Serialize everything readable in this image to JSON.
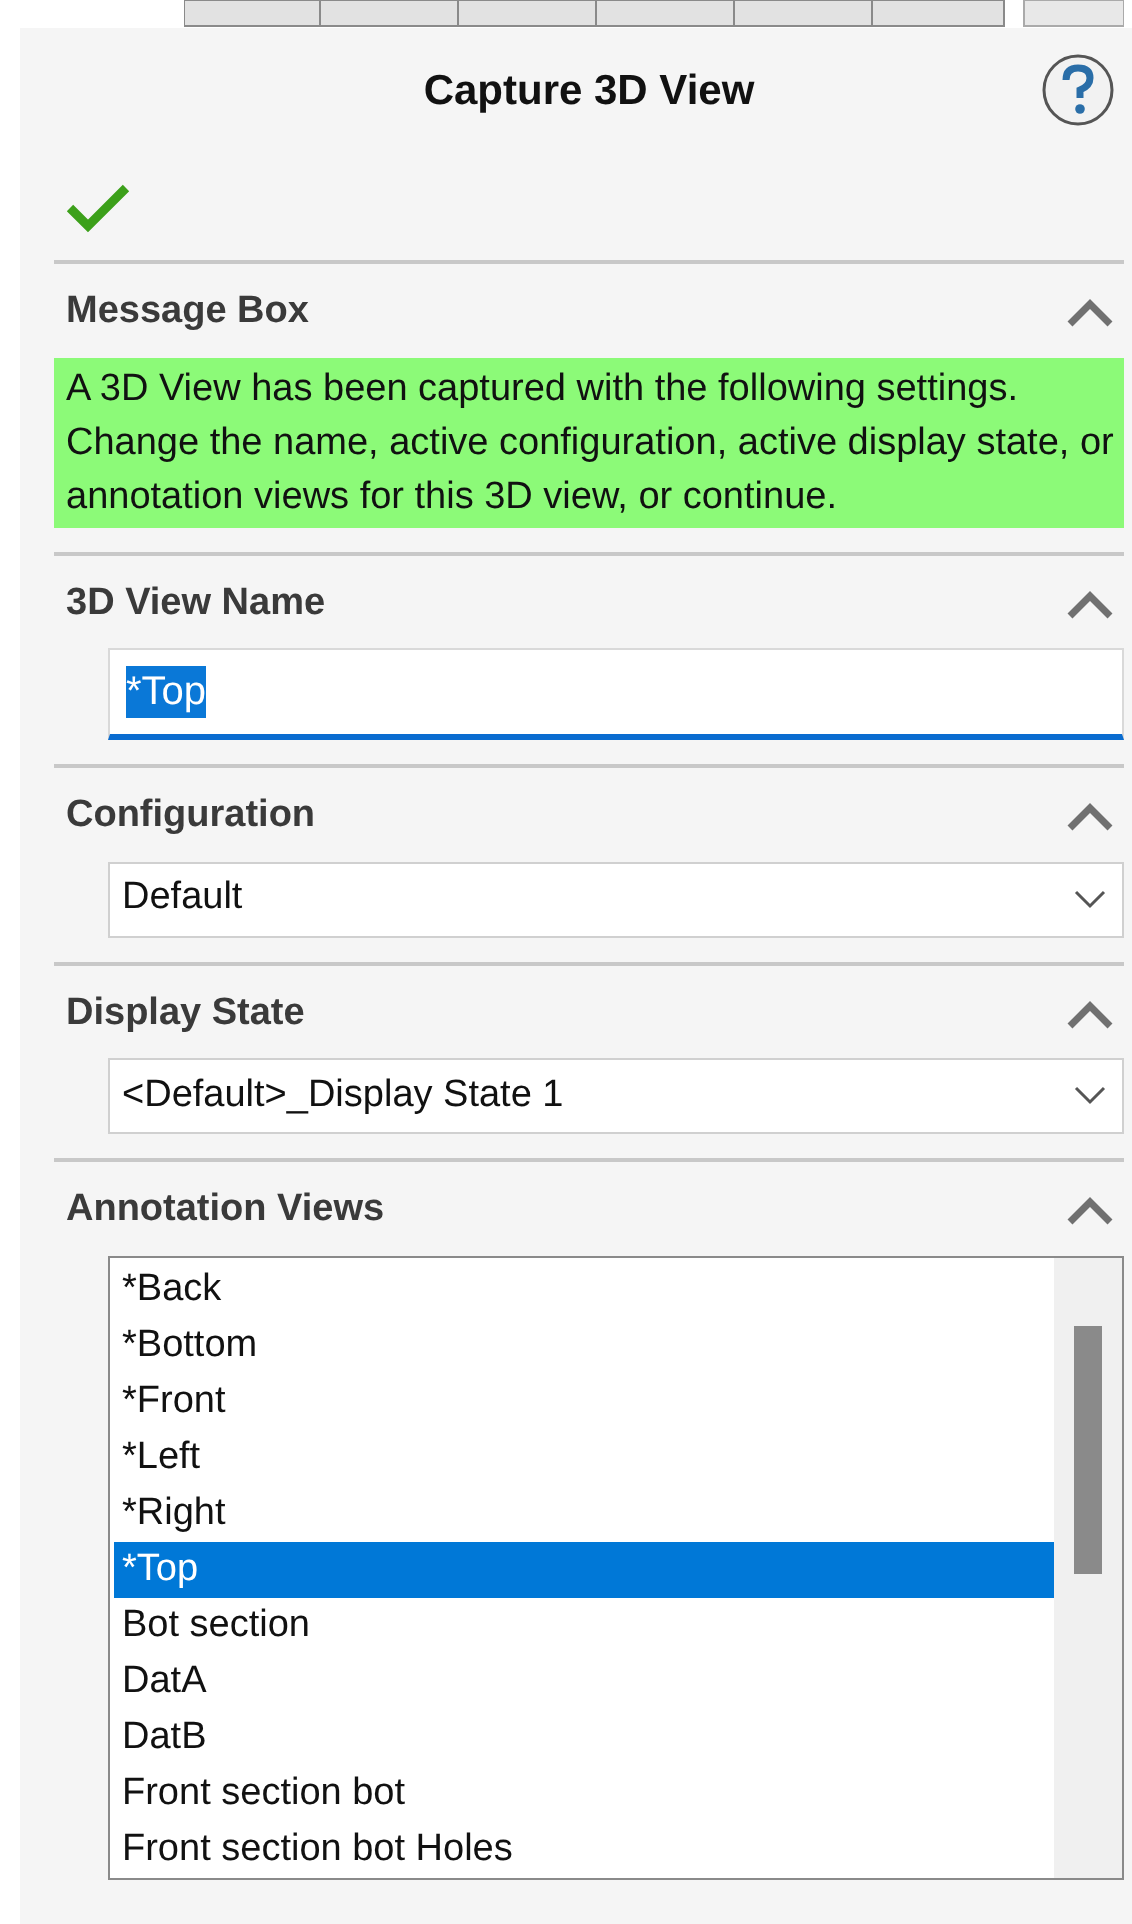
{
  "panel": {
    "title": "Capture 3D View"
  },
  "sections": [
    {
      "kind": "message",
      "title": "Message Box",
      "expanded": true,
      "text": "A 3D View has been captured with the following settings.  Change the name, active configuration, active display state, or annotation views for this 3D view, or continue."
    },
    {
      "kind": "text_field",
      "title": "3D View Name",
      "expanded": true,
      "value": "*Top"
    },
    {
      "kind": "dropdown",
      "title": "Configuration",
      "expanded": true,
      "value": "Default"
    },
    {
      "kind": "dropdown",
      "title": "Display State",
      "expanded": true,
      "value": "<Default>_Display State 1"
    },
    {
      "kind": "list",
      "title": "Annotation Views",
      "expanded": true,
      "items": [
        {
          "label": "*Back",
          "selected": false
        },
        {
          "label": "*Bottom",
          "selected": false
        },
        {
          "label": "*Front",
          "selected": false
        },
        {
          "label": "*Left",
          "selected": false
        },
        {
          "label": "*Right",
          "selected": false
        },
        {
          "label": "*Top",
          "selected": true
        },
        {
          "label": "Bot section",
          "selected": false
        },
        {
          "label": "DatA",
          "selected": false
        },
        {
          "label": "DatB",
          "selected": false
        },
        {
          "label": "Front section bot",
          "selected": false
        },
        {
          "label": "Front section bot Holes",
          "selected": false
        }
      ]
    }
  ]
}
